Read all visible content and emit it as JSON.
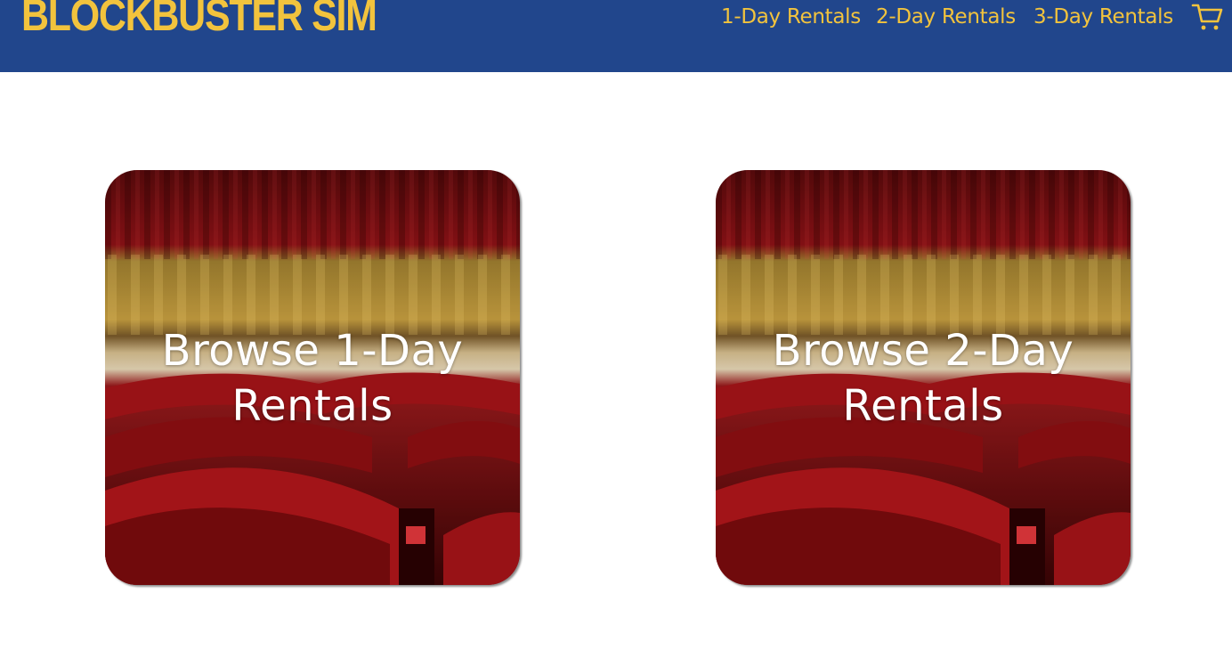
{
  "header": {
    "brand": "BLOCKBUSTER SIM",
    "nav": [
      {
        "label": "1-Day Rentals"
      },
      {
        "label": "2-Day Rentals"
      },
      {
        "label": "3-Day Rentals"
      }
    ],
    "cart_icon": "shopping-cart-icon"
  },
  "cards": [
    {
      "line1": "Browse 1-Day",
      "line2": "Rentals",
      "image": "theater-seats-image"
    },
    {
      "line1": "Browse 2-Day",
      "line2": "Rentals",
      "image": "theater-seats-image"
    }
  ],
  "colors": {
    "header_bg": "#21468c",
    "accent": "#f2c33d",
    "card_text": "#ffffff"
  }
}
